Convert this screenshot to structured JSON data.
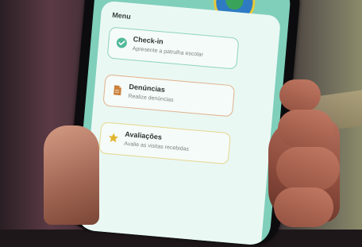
{
  "menu": {
    "title": "Menu",
    "items": [
      {
        "title": "Check-in",
        "subtitle": "Apresente a patrulha escolar",
        "icon": "check-circle-icon",
        "accent": "#52b99a"
      },
      {
        "title": "Denúncias",
        "subtitle": "Realize denúncias",
        "icon": "document-icon",
        "accent": "#c9803c"
      },
      {
        "title": "Avaliações",
        "subtitle": "Avalie as visitas recebidas",
        "icon": "star-icon",
        "accent": "#e1b530"
      }
    ]
  },
  "colors": {
    "screen_background": "#7fcfbb",
    "panel_background": "#eaf8f3"
  }
}
